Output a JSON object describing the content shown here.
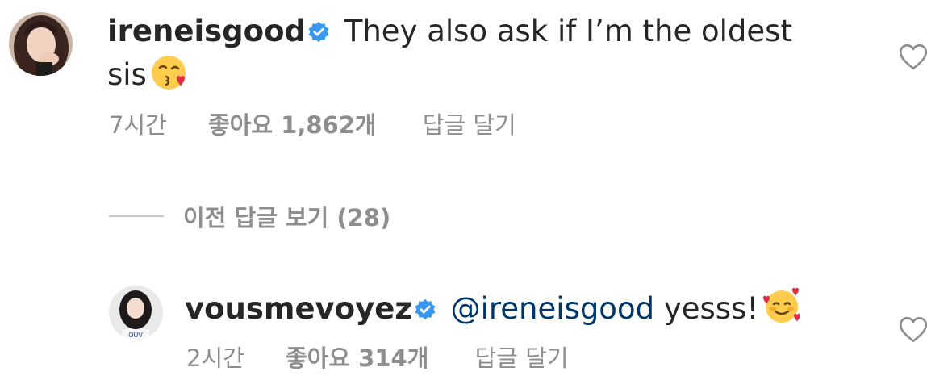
{
  "comments": [
    {
      "username": "ireneisgood",
      "text": "They also ask if I’m the oldest sis",
      "emoji": "face-blowing-a-kiss",
      "time": "7시간",
      "likes": "좋아요 1,862개",
      "reply": "답글 달기"
    },
    {
      "username": "vousmevoyez",
      "mention": "@ireneisgood",
      "text": "yesss!",
      "emoji": "smiling-face-with-hearts",
      "time": "2시간",
      "likes": "좋아요 314개",
      "reply": "답글 달기"
    }
  ],
  "view_replies": {
    "label": "이전 답글 보기 (28)"
  },
  "colors": {
    "text": "#262626",
    "secondary": "#8e8e8e",
    "mention": "#00376b",
    "verified": "#3897f0",
    "divider": "#c7c7c7"
  }
}
